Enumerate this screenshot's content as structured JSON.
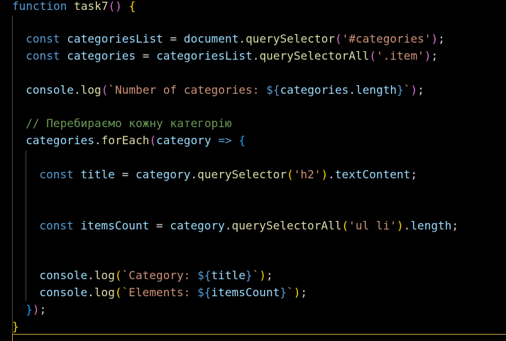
{
  "colors": {
    "background": "#000000",
    "text": "#d4d4d4",
    "keyword": "#569cd6",
    "function": "#dcdcaa",
    "variable": "#9cdcfe",
    "string": "#ce9178",
    "comment": "#6a9955",
    "bracket_gold": "#ffd700",
    "bracket_purple": "#da70d6",
    "bracket_blue": "#179fff",
    "indent_guide": "#4a4a4a",
    "scope_line": "#c8a23a"
  },
  "code": {
    "lines": [
      {
        "indent": 0,
        "tokens": [
          {
            "t": "function",
            "c": "keyword"
          },
          {
            "t": " ",
            "c": "text"
          },
          {
            "t": "task7",
            "c": "function"
          },
          {
            "t": "()",
            "c": "bracket_purple"
          },
          {
            "t": " ",
            "c": "text"
          },
          {
            "t": "{",
            "c": "bracket_gold"
          }
        ]
      },
      {
        "indent": 0,
        "tokens": []
      },
      {
        "indent": 2,
        "tokens": [
          {
            "t": "const",
            "c": "keyword"
          },
          {
            "t": " ",
            "c": "text"
          },
          {
            "t": "categoriesList",
            "c": "variable"
          },
          {
            "t": " = ",
            "c": "text"
          },
          {
            "t": "document",
            "c": "variable"
          },
          {
            "t": ".",
            "c": "text"
          },
          {
            "t": "querySelector",
            "c": "function"
          },
          {
            "t": "(",
            "c": "bracket_purple"
          },
          {
            "t": "'#categories'",
            "c": "string"
          },
          {
            "t": ")",
            "c": "bracket_purple"
          },
          {
            "t": ";",
            "c": "text"
          }
        ]
      },
      {
        "indent": 2,
        "tokens": [
          {
            "t": "const",
            "c": "keyword"
          },
          {
            "t": " ",
            "c": "text"
          },
          {
            "t": "categories",
            "c": "variable"
          },
          {
            "t": " = ",
            "c": "text"
          },
          {
            "t": "categoriesList",
            "c": "variable"
          },
          {
            "t": ".",
            "c": "text"
          },
          {
            "t": "querySelectorAll",
            "c": "function"
          },
          {
            "t": "(",
            "c": "bracket_purple"
          },
          {
            "t": "'.item'",
            "c": "string"
          },
          {
            "t": ")",
            "c": "bracket_purple"
          },
          {
            "t": ";",
            "c": "text"
          }
        ]
      },
      {
        "indent": 0,
        "tokens": []
      },
      {
        "indent": 2,
        "tokens": [
          {
            "t": "console",
            "c": "variable"
          },
          {
            "t": ".",
            "c": "text"
          },
          {
            "t": "log",
            "c": "function"
          },
          {
            "t": "(",
            "c": "bracket_purple"
          },
          {
            "t": "`Number of categories: ",
            "c": "string"
          },
          {
            "t": "${",
            "c": "keyword"
          },
          {
            "t": "categories",
            "c": "variable"
          },
          {
            "t": ".",
            "c": "text"
          },
          {
            "t": "length",
            "c": "variable"
          },
          {
            "t": "}",
            "c": "keyword"
          },
          {
            "t": "`",
            "c": "string"
          },
          {
            "t": ")",
            "c": "bracket_purple"
          },
          {
            "t": ";",
            "c": "text"
          }
        ]
      },
      {
        "indent": 0,
        "tokens": []
      },
      {
        "indent": 2,
        "tokens": [
          {
            "t": "// Перебираємо кожну категорію",
            "c": "comment"
          }
        ]
      },
      {
        "indent": 2,
        "tokens": [
          {
            "t": "categories",
            "c": "variable"
          },
          {
            "t": ".",
            "c": "text"
          },
          {
            "t": "forEach",
            "c": "function"
          },
          {
            "t": "(",
            "c": "bracket_purple"
          },
          {
            "t": "category",
            "c": "variable"
          },
          {
            "t": " ",
            "c": "text"
          },
          {
            "t": "=>",
            "c": "keyword"
          },
          {
            "t": " ",
            "c": "text"
          },
          {
            "t": "{",
            "c": "bracket_blue"
          }
        ]
      },
      {
        "indent": 0,
        "tokens": []
      },
      {
        "indent": 4,
        "tokens": [
          {
            "t": "const",
            "c": "keyword"
          },
          {
            "t": " ",
            "c": "text"
          },
          {
            "t": "title",
            "c": "variable"
          },
          {
            "t": " = ",
            "c": "text"
          },
          {
            "t": "category",
            "c": "variable"
          },
          {
            "t": ".",
            "c": "text"
          },
          {
            "t": "querySelector",
            "c": "function"
          },
          {
            "t": "(",
            "c": "bracket_gold"
          },
          {
            "t": "'h2'",
            "c": "string"
          },
          {
            "t": ")",
            "c": "bracket_gold"
          },
          {
            "t": ".",
            "c": "text"
          },
          {
            "t": "textContent",
            "c": "variable"
          },
          {
            "t": ";",
            "c": "text"
          }
        ]
      },
      {
        "indent": 0,
        "tokens": []
      },
      {
        "indent": 0,
        "tokens": []
      },
      {
        "indent": 4,
        "tokens": [
          {
            "t": "const",
            "c": "keyword"
          },
          {
            "t": " ",
            "c": "text"
          },
          {
            "t": "itemsCount",
            "c": "variable"
          },
          {
            "t": " = ",
            "c": "text"
          },
          {
            "t": "category",
            "c": "variable"
          },
          {
            "t": ".",
            "c": "text"
          },
          {
            "t": "querySelectorAll",
            "c": "function"
          },
          {
            "t": "(",
            "c": "bracket_gold"
          },
          {
            "t": "'ul li'",
            "c": "string"
          },
          {
            "t": ")",
            "c": "bracket_gold"
          },
          {
            "t": ".",
            "c": "text"
          },
          {
            "t": "length",
            "c": "variable"
          },
          {
            "t": ";",
            "c": "text"
          }
        ]
      },
      {
        "indent": 0,
        "tokens": []
      },
      {
        "indent": 0,
        "tokens": []
      },
      {
        "indent": 4,
        "tokens": [
          {
            "t": "console",
            "c": "variable"
          },
          {
            "t": ".",
            "c": "text"
          },
          {
            "t": "log",
            "c": "function"
          },
          {
            "t": "(",
            "c": "bracket_gold"
          },
          {
            "t": "`Category: ",
            "c": "string"
          },
          {
            "t": "${",
            "c": "keyword"
          },
          {
            "t": "title",
            "c": "variable"
          },
          {
            "t": "}",
            "c": "keyword"
          },
          {
            "t": "`",
            "c": "string"
          },
          {
            "t": ")",
            "c": "bracket_gold"
          },
          {
            "t": ";",
            "c": "text"
          }
        ]
      },
      {
        "indent": 4,
        "tokens": [
          {
            "t": "console",
            "c": "variable"
          },
          {
            "t": ".",
            "c": "text"
          },
          {
            "t": "log",
            "c": "function"
          },
          {
            "t": "(",
            "c": "bracket_gold"
          },
          {
            "t": "`Elements: ",
            "c": "string"
          },
          {
            "t": "${",
            "c": "keyword"
          },
          {
            "t": "itemsCount",
            "c": "variable"
          },
          {
            "t": "}",
            "c": "keyword"
          },
          {
            "t": "`",
            "c": "string"
          },
          {
            "t": ")",
            "c": "bracket_gold"
          },
          {
            "t": ";",
            "c": "text"
          }
        ]
      },
      {
        "indent": 2,
        "tokens": [
          {
            "t": "}",
            "c": "bracket_blue"
          },
          {
            "t": ")",
            "c": "bracket_purple"
          },
          {
            "t": ";",
            "c": "text"
          }
        ]
      },
      {
        "indent": 0,
        "tokens": [
          {
            "t": "}",
            "c": "bracket_gold"
          }
        ]
      }
    ]
  }
}
